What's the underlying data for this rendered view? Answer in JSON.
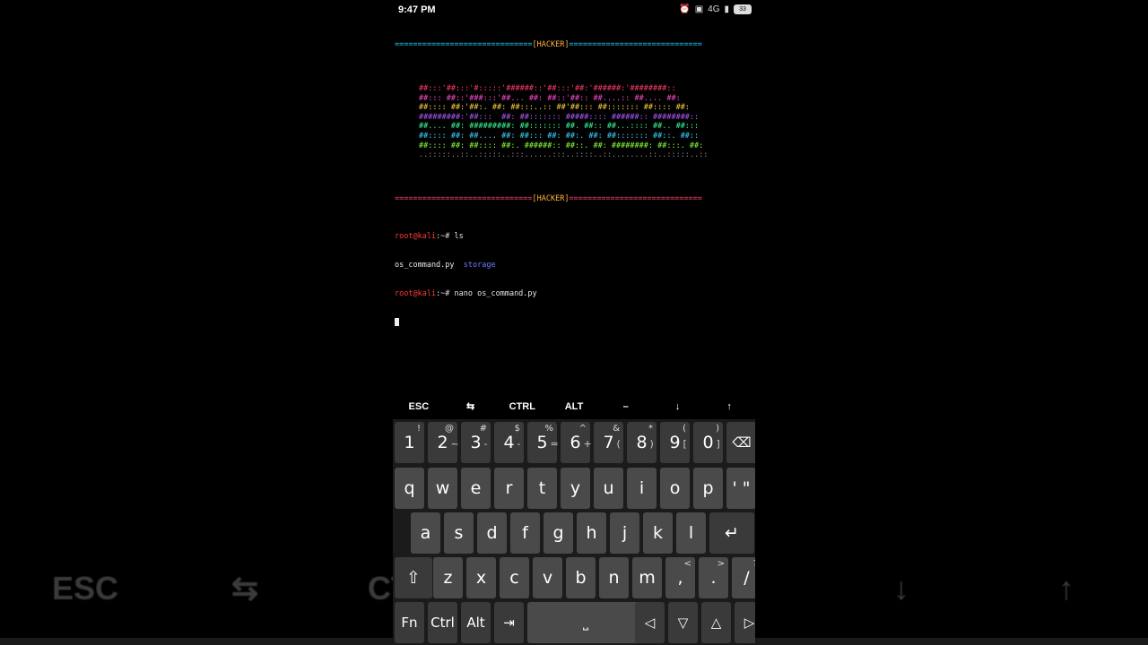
{
  "status_bar": {
    "time": "9:47 PM",
    "signal": "4G",
    "battery": "33"
  },
  "terminal": {
    "separator_label": "[HACKER]",
    "separator_pad_left": "==============================",
    "separator_pad_right": "=============================",
    "banner_lines": [
      "##:::'##:::'#:::::'######::'##:::'##:'######:'########::",
      "##::: ##::'###:::'##... ##: ##::'##:: ##....:: ##.... ##:",
      "##:::: ##:'##:. ##: ##:::..:: ##'##::: ##::::::: ##:::: ##:",
      "#########:'##:::  ##: ##::::::: #####:::: ######:: ########::",
      "##.... ##: #########: ##::::::: ##. ##:: ##...:::: ##.. ##:::",
      "##:::: ##: ##.... ##: ##::: ##: ##:. ##: ##::::::: ##::. ##::",
      "##:::: ##: ##:::: ##:. ######:: ##::. ##: ########: ##:::. ##:",
      "..:::::..::..:::::..:::......:::..::::..::........::..:::::..::"
    ],
    "banner_colors": [
      "#ff3b6b",
      "#ff4bd0",
      "#ffd23f",
      "#b05cff",
      "#3bff9b",
      "#3bd6ff",
      "#8cff3b",
      "#8a8a8a"
    ],
    "lines": [
      {
        "user": "root@kali",
        "path": ":~#",
        "command": " ls"
      },
      {
        "output_file": "os_command.py",
        "output_dir": "storage"
      },
      {
        "user": "root@kali",
        "path": ":~#",
        "command": " nano os_command.py"
      }
    ]
  },
  "extra_keys": [
    "ESC",
    "⇆",
    "CTRL",
    "ALT",
    "–",
    "↓",
    "↑"
  ],
  "keyboard": {
    "number_row": [
      {
        "key": "1",
        "sup": "!"
      },
      {
        "key": "2",
        "sup": "@",
        "sub": "~"
      },
      {
        "key": "3",
        "sup": "#",
        "sub": "-"
      },
      {
        "key": "4",
        "sup": "$",
        "sub": "-"
      },
      {
        "key": "5",
        "sup": "%",
        "sub": "="
      },
      {
        "key": "6",
        "sup": "^",
        "sub": "+"
      },
      {
        "key": "7",
        "sup": "&",
        "sub": "("
      },
      {
        "key": "8",
        "sup": "*",
        "sub": ")"
      },
      {
        "key": "9",
        "sup": "(",
        "sub": "["
      },
      {
        "key": "0",
        "sup": ")",
        "sub": "]"
      }
    ],
    "row1": [
      "q",
      "w",
      "e",
      "r",
      "t",
      "y",
      "u",
      "i",
      "o",
      "p",
      "' \""
    ],
    "row2": [
      "a",
      "s",
      "d",
      "f",
      "g",
      "h",
      "j",
      "k",
      "l"
    ],
    "row3": [
      "z",
      "x",
      "c",
      "v",
      "b",
      "n",
      "m"
    ],
    "row3_punct": [
      {
        "key": ",",
        "sup": "<"
      },
      {
        "key": ".",
        "sup": ">"
      },
      {
        "key": "/",
        "sup": "?"
      }
    ],
    "bottom": {
      "fn": "Fn",
      "ctrl": "Ctrl",
      "alt": "Alt",
      "tab": "⇥",
      "space": "⎵",
      "left": "◁",
      "down": "▽",
      "up": "△",
      "right": "▷"
    },
    "backspace": "⌫",
    "enter": "↵",
    "shift": "⇧"
  },
  "background_labels": {
    "esc": "ESC",
    "tab": "⇆",
    "ctrl": "CT",
    "down": "↓",
    "up": "↑"
  }
}
